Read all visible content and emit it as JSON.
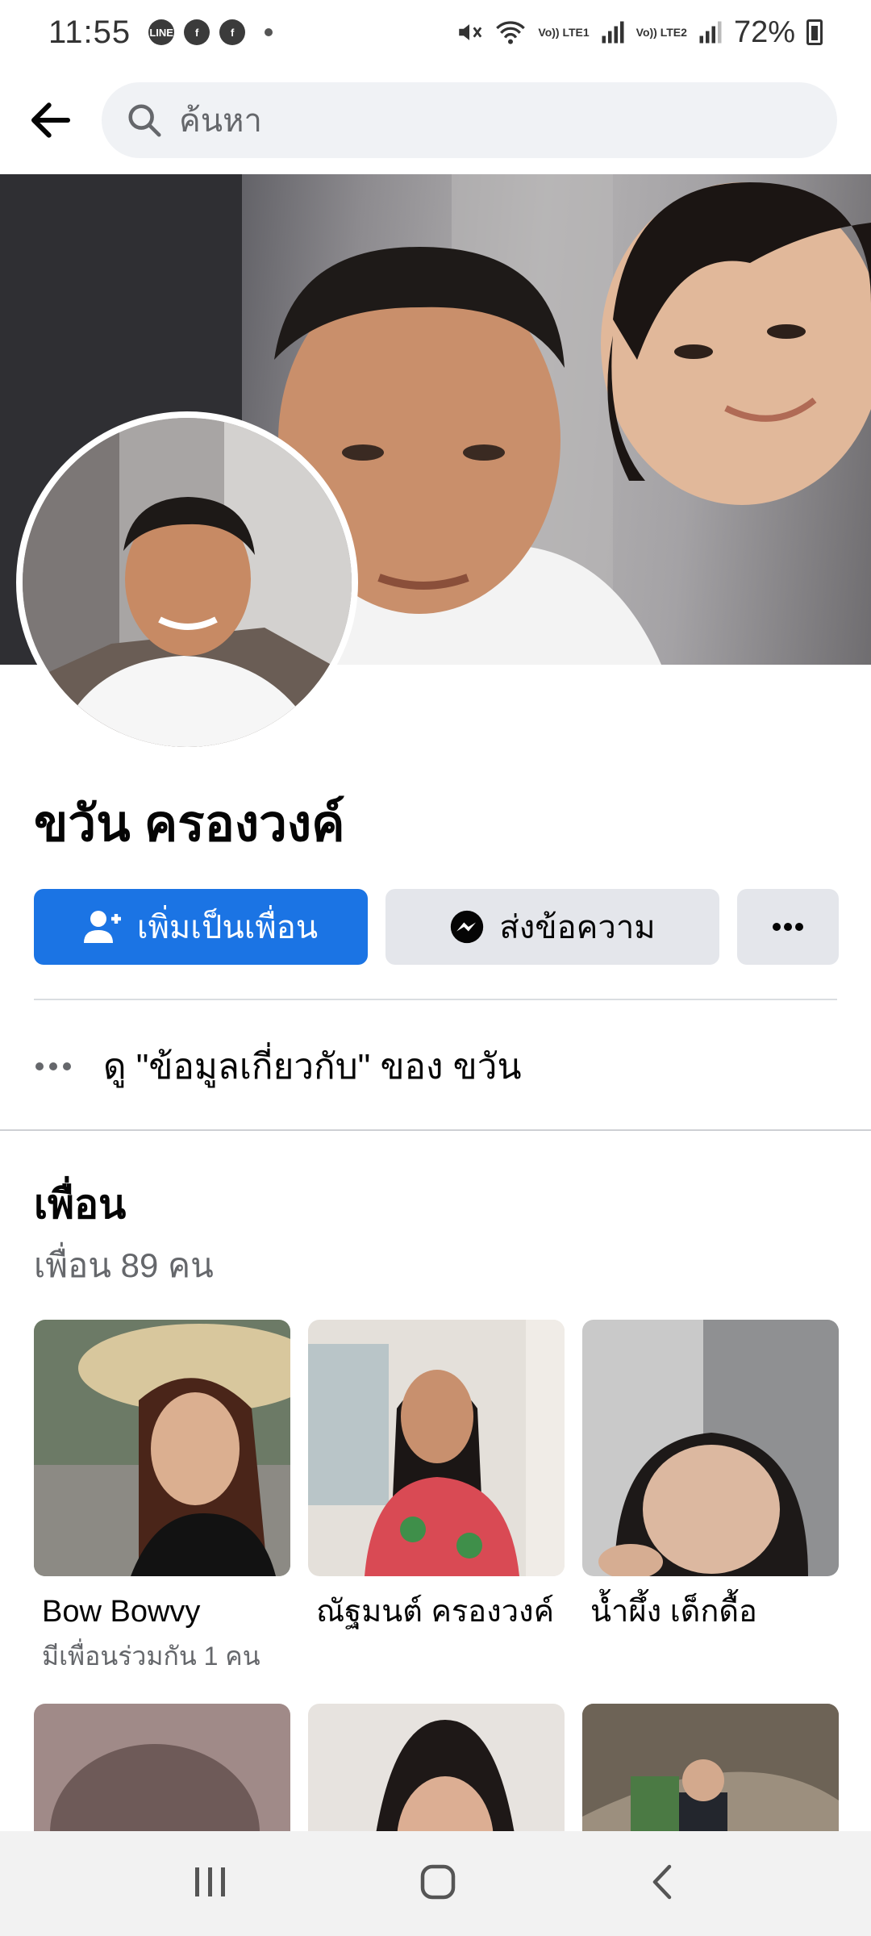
{
  "status_bar": {
    "time": "11:55",
    "app_icons": [
      "line-icon",
      "facebook-icon",
      "facebook-icon"
    ],
    "line_label": "LINE",
    "fb_label": "f",
    "network_1": "Vo)) LTE1",
    "network_2": "Vo)) LTE2",
    "battery": "72%"
  },
  "header": {
    "search_placeholder": "ค้นหา"
  },
  "profile": {
    "name": "ขวัน ครองวงค์",
    "add_friend_label": "เพิ่มเป็นเพื่อน",
    "message_label": "ส่งข้อความ",
    "more_label": "...",
    "about_text": "ดู \"ข้อมูลเกี่ยวกับ\" ของ ขวัน"
  },
  "friends": {
    "title": "เพื่อน",
    "count_text": "เพื่อน 89 คน",
    "items": [
      {
        "name": "Bow Bowvy",
        "mutual": "มีเพื่อนร่วมกัน 1 คน"
      },
      {
        "name": "ณัฐมนต์ ครองวงค์",
        "mutual": ""
      },
      {
        "name": "น้ำผึ้ง เด็กดื้อ",
        "mutual": ""
      }
    ]
  },
  "colors": {
    "accent": "#1b74e4",
    "secondary_button": "#e4e6eb",
    "muted_text": "#65676b"
  }
}
